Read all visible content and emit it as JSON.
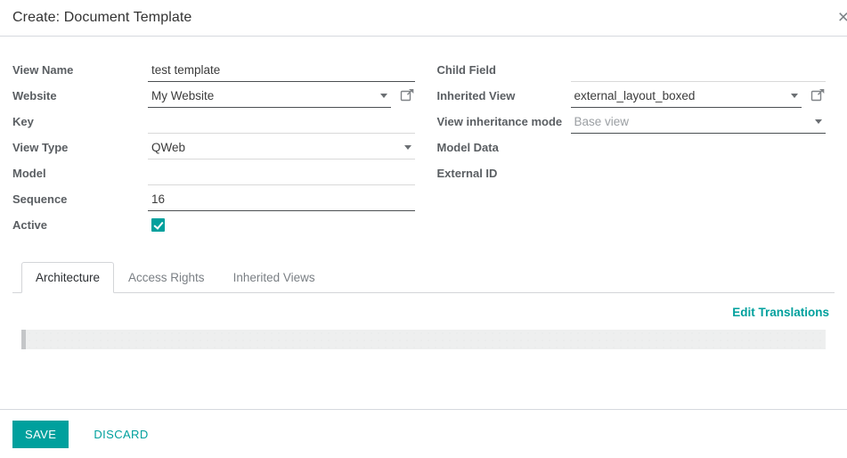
{
  "dialog": {
    "title": "Create: Document Template",
    "close_label": "×"
  },
  "form": {
    "left_fields": [
      {
        "label": "View Name",
        "value": "test template",
        "type": "text",
        "emphasis": "dark"
      },
      {
        "label": "Website",
        "value": "My Website",
        "type": "select",
        "emphasis": "dark",
        "external_link": true
      },
      {
        "label": "Key",
        "value": "",
        "type": "text",
        "emphasis": "light"
      },
      {
        "label": "View Type",
        "value": "QWeb",
        "type": "select",
        "emphasis": "light"
      },
      {
        "label": "Model",
        "value": "",
        "type": "text",
        "emphasis": "light"
      },
      {
        "label": "Sequence",
        "value": "16",
        "type": "text",
        "emphasis": "dark"
      },
      {
        "label": "Active",
        "value": "checked",
        "type": "checkbox"
      }
    ],
    "right_fields": [
      {
        "label": "Child Field",
        "value": "",
        "type": "text",
        "emphasis": "light"
      },
      {
        "label": "Inherited View",
        "value": "external_layout_boxed",
        "type": "select",
        "emphasis": "dark",
        "external_link": true
      },
      {
        "label": "View inheritance mode",
        "value": "Base view",
        "type": "select",
        "emphasis": "dark",
        "muted": true
      },
      {
        "label": "Model Data",
        "value": "",
        "type": "none"
      },
      {
        "label": "External ID",
        "value": "",
        "type": "none"
      }
    ]
  },
  "notebook": {
    "tabs": [
      {
        "label": "Architecture",
        "active": true
      },
      {
        "label": "Access Rights",
        "active": false
      },
      {
        "label": "Inherited Views",
        "active": false
      }
    ],
    "translations_link": "Edit Translations",
    "code_content": ""
  },
  "footer": {
    "save_label": "SAVE",
    "discard_label": "DISCARD"
  },
  "colors": {
    "accent": "#00a09d",
    "divider": "#d6d9de",
    "label": "#5a5e62"
  }
}
